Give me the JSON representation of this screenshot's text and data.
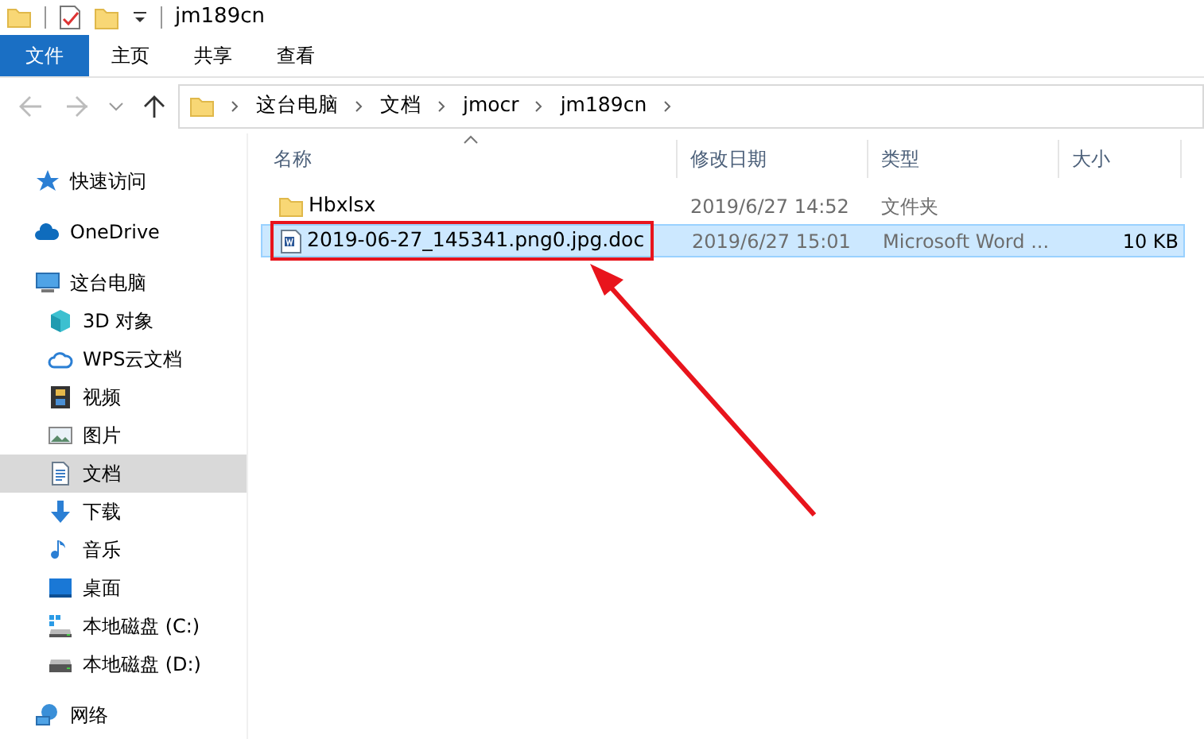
{
  "window": {
    "title": "jm189cn"
  },
  "ribbon_tabs": [
    {
      "label": "文件",
      "kind": "file",
      "selected": false
    },
    {
      "label": "主页",
      "kind": "tab",
      "selected": false
    },
    {
      "label": "共享",
      "kind": "tab",
      "selected": false
    },
    {
      "label": "查看",
      "kind": "tab",
      "selected": false
    }
  ],
  "navigation": {
    "back": {
      "disabled": true
    },
    "forward": {
      "disabled": true
    }
  },
  "address_bar": {
    "crumbs": [
      "这台电脑",
      "文档",
      "jmocr",
      "jm189cn"
    ]
  },
  "sidebar": {
    "items": [
      {
        "label": "快速访问",
        "kind": "star",
        "selected": false
      },
      {
        "label": "OneDrive",
        "kind": "cloud",
        "selected": false
      },
      {
        "label": "这台电脑",
        "kind": "pc",
        "selected": false,
        "children": [
          {
            "label": "3D 对象",
            "kind": "cube",
            "selected": false
          },
          {
            "label": "WPS云文档",
            "kind": "cloud-outline",
            "selected": false
          },
          {
            "label": "视频",
            "kind": "film",
            "selected": false
          },
          {
            "label": "图片",
            "kind": "image",
            "selected": false
          },
          {
            "label": "文档",
            "kind": "doc",
            "selected": true
          },
          {
            "label": "下载",
            "kind": "download",
            "selected": false
          },
          {
            "label": "音乐",
            "kind": "music",
            "selected": false
          },
          {
            "label": "桌面",
            "kind": "desktop",
            "selected": false
          },
          {
            "label": "本地磁盘 (C:)",
            "kind": "drive-win",
            "selected": false
          },
          {
            "label": "本地磁盘 (D:)",
            "kind": "drive",
            "selected": false
          }
        ]
      },
      {
        "label": "网络",
        "kind": "network",
        "selected": false
      }
    ]
  },
  "file_list": {
    "columns": [
      "名称",
      "修改日期",
      "类型",
      "大小"
    ],
    "rows": [
      {
        "kind": "folder",
        "name": "Hbxlsx",
        "modified": "2019/6/27 14:52",
        "type": "文件夹",
        "selected": false,
        "highlighted": false
      },
      {
        "kind": "doc",
        "name": "2019-06-27_145341.png0.jpg.doc",
        "modified": "2019/6/27 15:01",
        "type": "Microsoft Word ...",
        "size": "10 KB",
        "selected": true,
        "highlighted": true
      }
    ]
  }
}
